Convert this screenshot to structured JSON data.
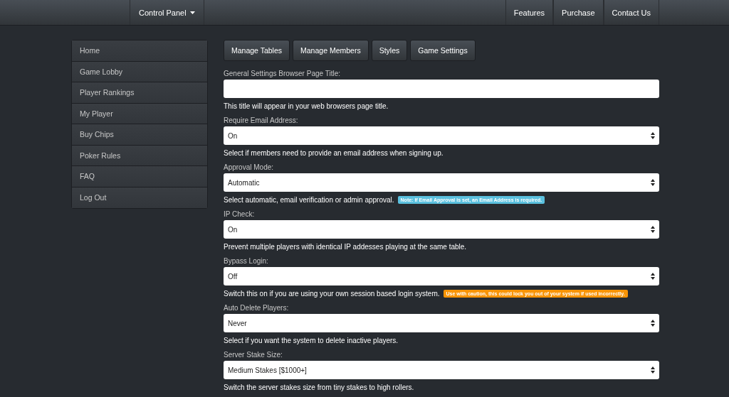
{
  "navbar": {
    "brand_menu": "Control Panel",
    "links": [
      "Features",
      "Purchase",
      "Contact Us"
    ]
  },
  "sidebar": {
    "items": [
      "Home",
      "Game Lobby",
      "Player Rankings",
      "My Player",
      "Buy Chips",
      "Poker Rules",
      "FAQ",
      "Log Out"
    ]
  },
  "tab_buttons": [
    "Manage Tables",
    "Manage Members",
    "Styles",
    "Game Settings"
  ],
  "fields": [
    {
      "kind": "text",
      "label": "General Settings Browser Page Title:",
      "help": "This title will appear in your web browsers page title."
    },
    {
      "kind": "select",
      "label": "Require Email Address:",
      "value": "On",
      "help": "Select if members need to provide an email address when signing up."
    },
    {
      "kind": "select",
      "label": "Approval Mode:",
      "value": "Automatic",
      "help": "Select automatic, email verification or admin approval.",
      "badge": {
        "kind": "info",
        "text": "Note: If Email Approval is set, an Email Address is required."
      }
    },
    {
      "kind": "select",
      "label": "IP Check:",
      "value": "On",
      "help": "Prevent multiple players with identical IP addesses playing at the same table."
    },
    {
      "kind": "select",
      "label": "Bypass Login:",
      "value": "Off",
      "help": "Switch this on if you are using your own session based login system.",
      "badge": {
        "kind": "warning",
        "text": "Use with caution, this could lock you out of your system if used incorrectly."
      }
    },
    {
      "kind": "select",
      "label": "Auto Delete Players:",
      "value": "Never",
      "help": "Select if you want the system to delete inactive players."
    },
    {
      "kind": "select",
      "label": "Server Stake Size:",
      "value": "Medium Stakes [$1000+]",
      "help": "Switch the server stakes size from tiny stakes to high rollers."
    }
  ]
}
